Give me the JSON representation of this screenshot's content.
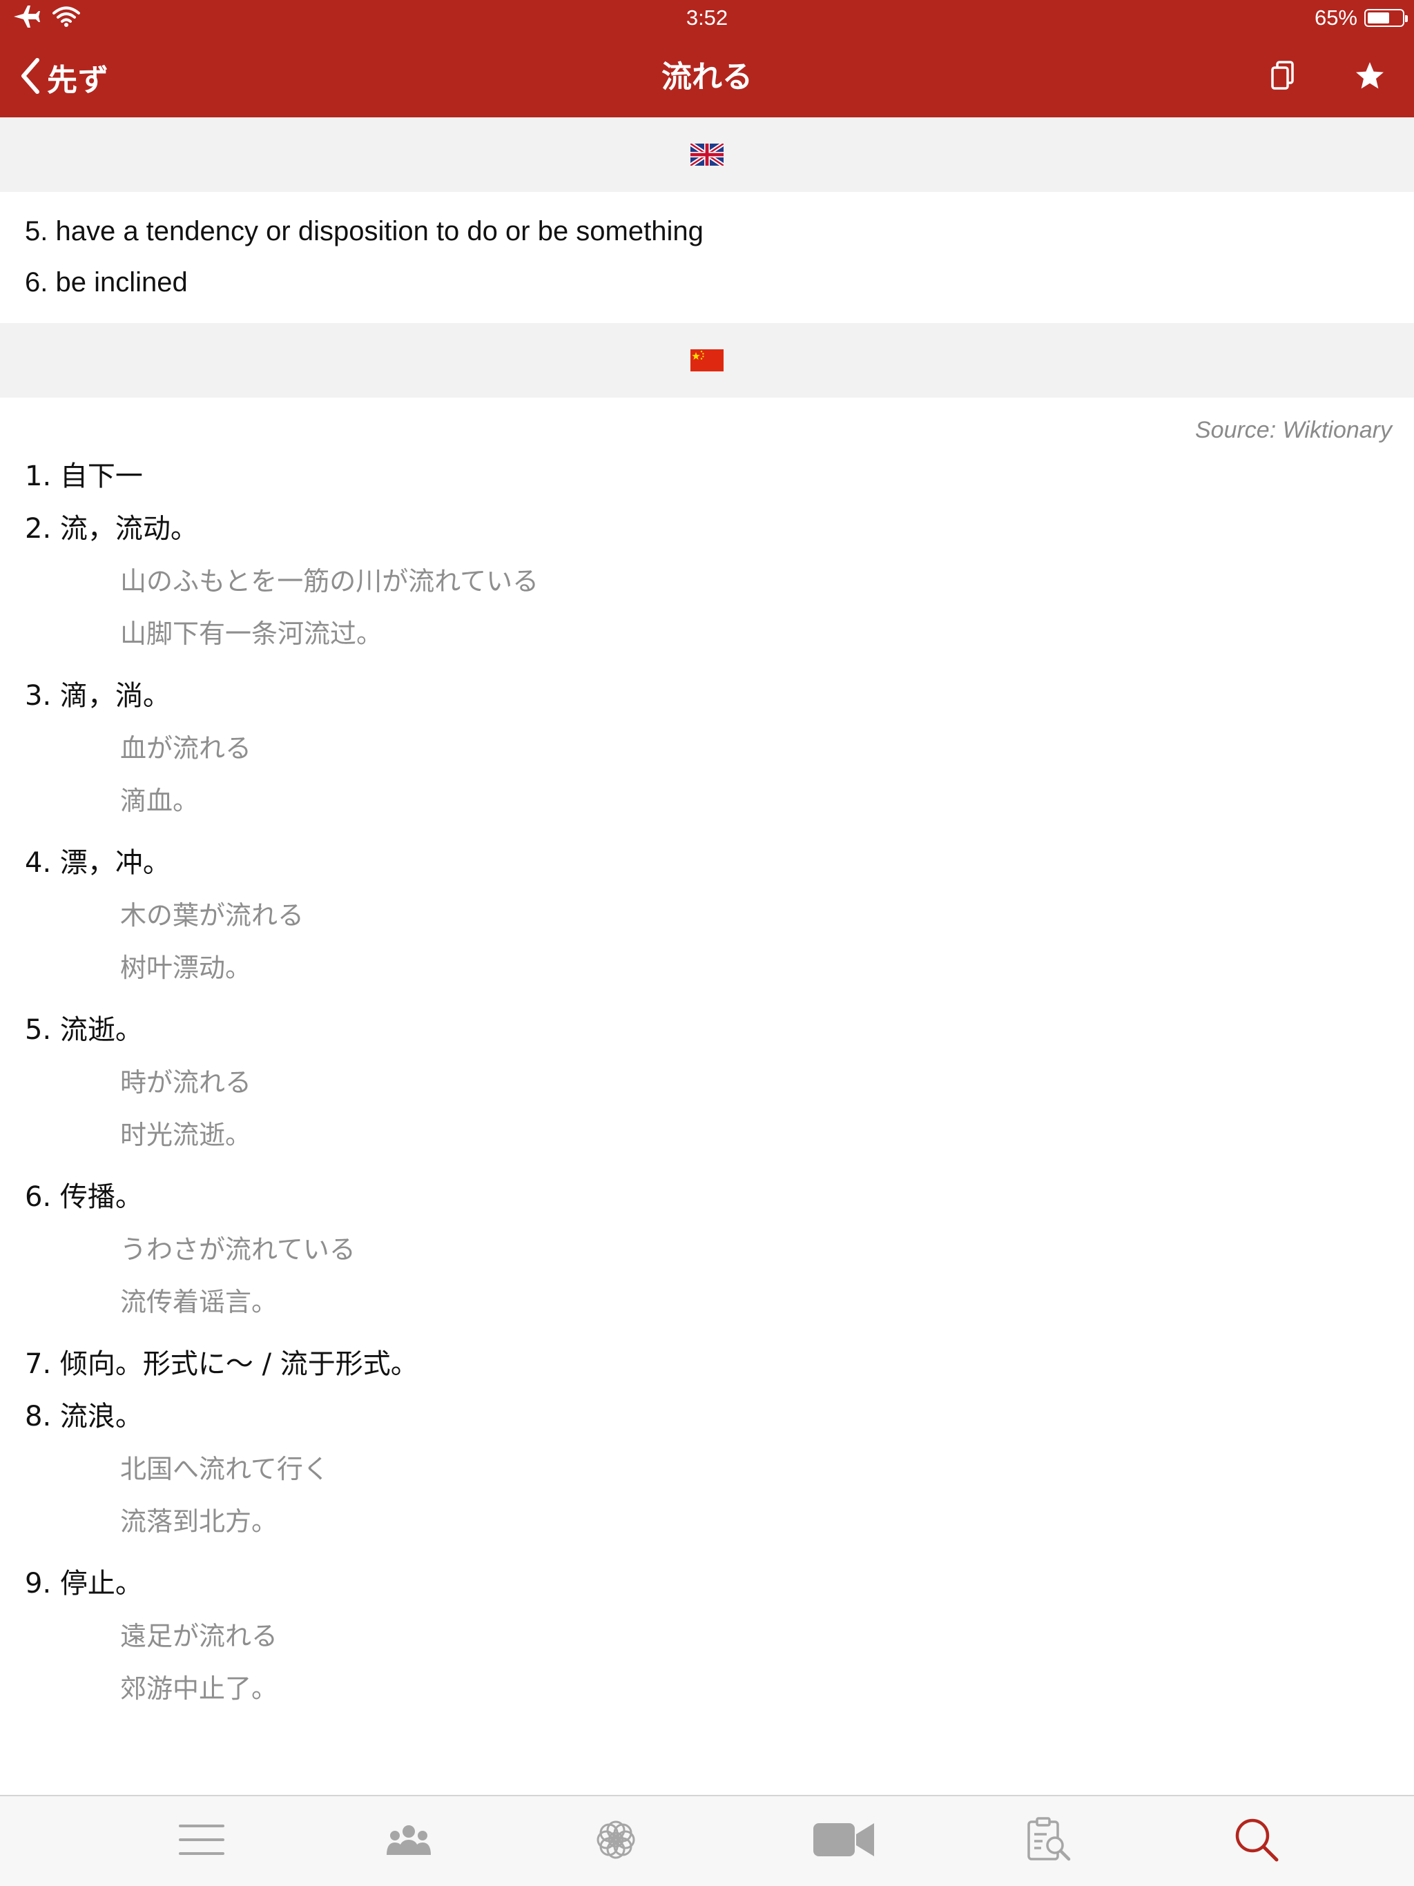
{
  "status_bar": {
    "time": "3:52",
    "battery_percent_label": "65%",
    "battery_level": 0.65,
    "icons": [
      "airplane-icon",
      "wifi-icon",
      "battery-icon"
    ]
  },
  "nav": {
    "back_label": "先ず",
    "title": "流れる",
    "actions": [
      "copy-icon",
      "star-icon"
    ]
  },
  "theme": {
    "header_bg": "#b3261e",
    "band_bg": "#f2f2f2",
    "example_text": "#8e8e8e",
    "source_text": "#8a8a8a",
    "active_tab": "#b3261e",
    "inactive_tab": "#a6a6a6"
  },
  "english_section": {
    "flag": "uk-flag-icon",
    "definitions": [
      "5. have a tendency or disposition to do or be something",
      "6. be inclined"
    ]
  },
  "chinese_section": {
    "flag": "china-flag-icon",
    "source": "Source: Wiktionary",
    "senses": [
      {
        "head": "1. 自下一",
        "examples": []
      },
      {
        "head": "2. 流，流动。",
        "examples": [
          "山のふもとを一筋の川が流れている",
          "山脚下有一条河流过。"
        ]
      },
      {
        "head": "3. 滴，淌。",
        "examples": [
          "血が流れる",
          "滴血。"
        ]
      },
      {
        "head": "4. 漂，冲。",
        "examples": [
          "木の葉が流れる",
          "树叶漂动。"
        ]
      },
      {
        "head": "5. 流逝。",
        "examples": [
          "時が流れる",
          "时光流逝。"
        ]
      },
      {
        "head": "6. 传播。",
        "examples": [
          "うわさが流れている",
          "流传着谣言。"
        ]
      },
      {
        "head": "7. 倾向。形式に～ / 流于形式。",
        "examples": []
      },
      {
        "head": "8. 流浪。",
        "examples": [
          "北国へ流れて行く",
          "流落到北方。"
        ]
      },
      {
        "head": "9. 停止。",
        "examples": [
          "遠足が流れる",
          "郊游中止了。"
        ]
      }
    ]
  },
  "tabbar": {
    "tabs": [
      {
        "icon": "menu-icon",
        "active": false
      },
      {
        "icon": "community-icon",
        "active": false
      },
      {
        "icon": "lotus-icon",
        "active": false
      },
      {
        "icon": "video-icon",
        "active": false
      },
      {
        "icon": "quiz-icon",
        "active": false
      },
      {
        "icon": "search-icon",
        "active": true
      }
    ]
  }
}
